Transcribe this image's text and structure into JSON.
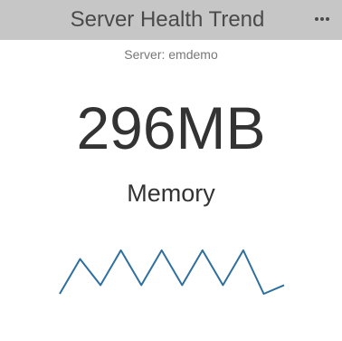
{
  "widget": {
    "title": "Server Health Trend",
    "more_icon": "more-icon",
    "subtitle": "Server: emdemo",
    "value": "296MB",
    "metric_label": "Memory"
  },
  "chart_data": {
    "type": "line",
    "x": [
      0,
      1,
      2,
      3,
      4,
      5,
      6,
      7,
      8,
      9,
      10,
      11
    ],
    "values": [
      1,
      5,
      2,
      6,
      2,
      6,
      2,
      6,
      2,
      6,
      1,
      2
    ],
    "grid": false,
    "color": "#2e6f9e"
  },
  "colors": {
    "title_bar": "#c6c6c6",
    "text": "#333333",
    "subtitle": "#777777",
    "sparkline": "#2e6f9e"
  }
}
